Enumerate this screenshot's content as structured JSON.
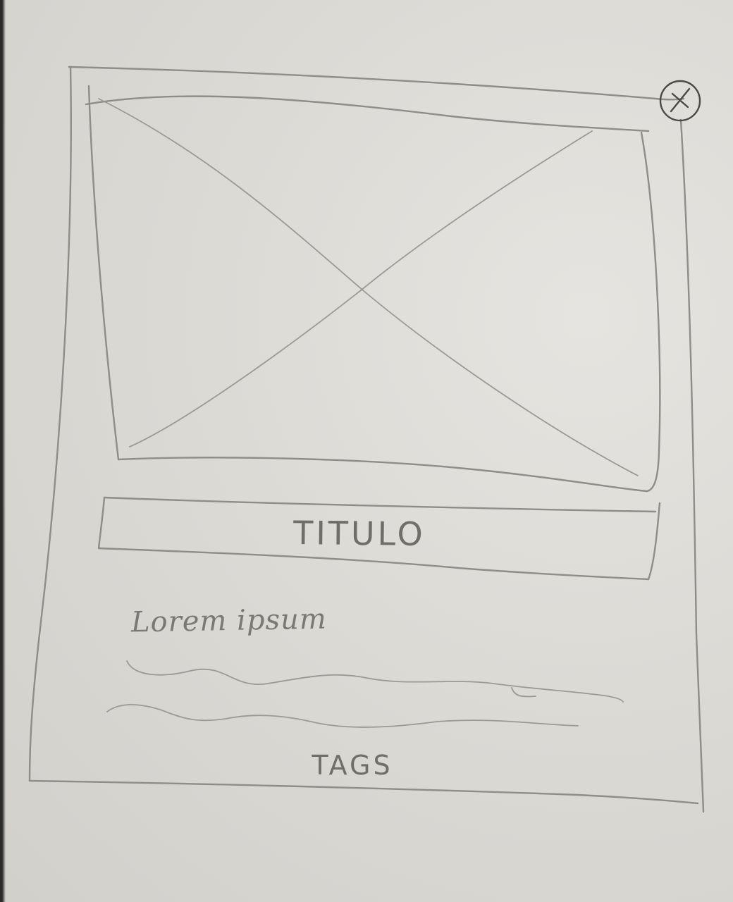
{
  "card": {
    "close_label": "×",
    "title": "TITULO",
    "description": "Lorem ipsum",
    "tags": "TAGS",
    "image_icon": "image-placeholder-icon",
    "close_icon": "close-icon"
  }
}
